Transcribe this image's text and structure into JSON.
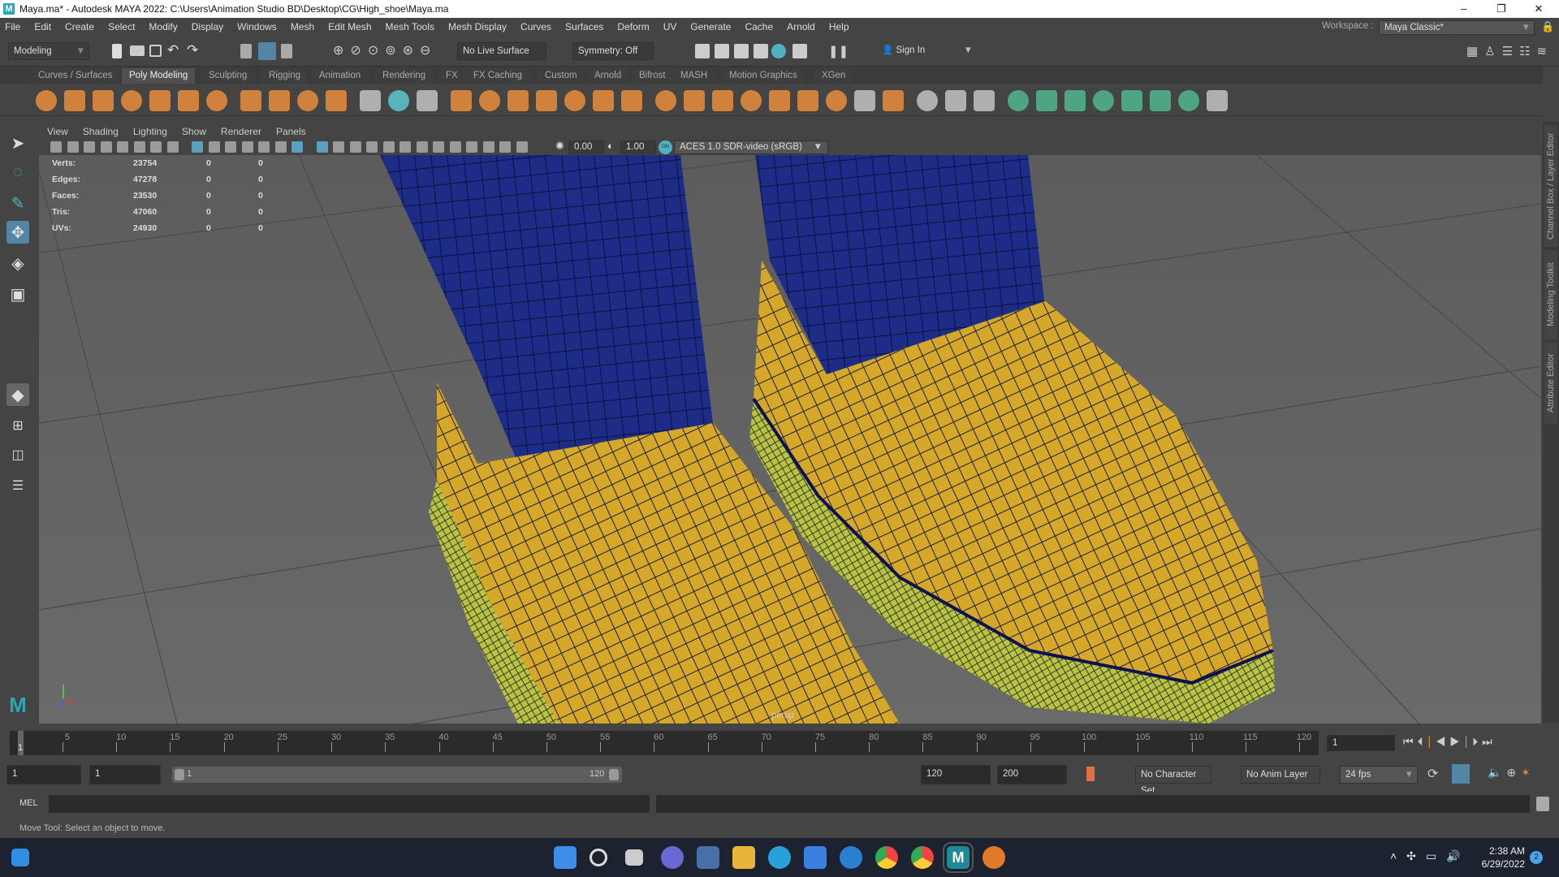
{
  "window": {
    "title": "Maya.ma* - Autodesk MAYA 2022: C:\\Users\\Animation Studio BD\\Desktop\\CG\\High_shoe\\Maya.ma",
    "minimize": "–",
    "maximize": "❐",
    "close": "✕"
  },
  "menubar": [
    "File",
    "Edit",
    "Create",
    "Select",
    "Modify",
    "Display",
    "Windows",
    "Mesh",
    "Edit Mesh",
    "Mesh Tools",
    "Mesh Display",
    "Curves",
    "Surfaces",
    "Deform",
    "UV",
    "Generate",
    "Cache",
    "Arnold",
    "Help"
  ],
  "workspace": {
    "label": "Workspace :",
    "value": "Maya Classic*"
  },
  "statusline": {
    "mode": "Modeling",
    "live_surface": "No Live Surface",
    "symmetry": "Symmetry: Off",
    "sign_in": "Sign In"
  },
  "shelf_tabs": [
    "Curves / Surfaces",
    "Poly Modeling",
    "Sculpting",
    "Rigging",
    "Animation",
    "Rendering",
    "FX",
    "FX Caching",
    "Custom",
    "Arnold",
    "Bifrost",
    "MASH",
    "Motion Graphics",
    "XGen"
  ],
  "active_shelf": "Poly Modeling",
  "shelf_icons": [
    {
      "name": "poly-sphere",
      "color": "#e08a3c"
    },
    {
      "name": "poly-cube",
      "color": "#e08a3c"
    },
    {
      "name": "poly-cylinder",
      "color": "#e08a3c"
    },
    {
      "name": "poly-cone",
      "color": "#e08a3c"
    },
    {
      "name": "poly-torus",
      "color": "#e08a3c"
    },
    {
      "name": "poly-plane",
      "color": "#e08a3c"
    },
    {
      "name": "poly-disc",
      "color": "#e08a3c"
    },
    {
      "name": "platonic-solid",
      "color": "#e08a3c"
    },
    {
      "name": "super-shape",
      "color": "#e08a3c"
    },
    {
      "name": "type",
      "color": "#e08a3c"
    },
    {
      "name": "svg",
      "color": "#e08a3c"
    },
    {
      "name": "combine",
      "color": "#bbbbbb"
    },
    {
      "name": "separate",
      "color": "#5cc0c8"
    },
    {
      "name": "smooth",
      "color": "#bbbbbb"
    },
    {
      "name": "extrude",
      "color": "#e08a3c"
    },
    {
      "name": "bridge",
      "color": "#e08a3c"
    },
    {
      "name": "bevel",
      "color": "#e08a3c"
    },
    {
      "name": "bool",
      "color": "#e08a3c"
    },
    {
      "name": "fill-hole",
      "color": "#e08a3c"
    },
    {
      "name": "mirror",
      "color": "#e08a3c"
    },
    {
      "name": "append",
      "color": "#e08a3c"
    },
    {
      "name": "multi-cut",
      "color": "#e08a3c"
    },
    {
      "name": "target-weld",
      "color": "#e08a3c"
    },
    {
      "name": "connect",
      "color": "#e08a3c"
    },
    {
      "name": "insert-loop",
      "color": "#e08a3c"
    },
    {
      "name": "offset-loop",
      "color": "#e08a3c"
    },
    {
      "name": "merge",
      "color": "#e08a3c"
    },
    {
      "name": "collapse",
      "color": "#e08a3c"
    },
    {
      "name": "quad-draw",
      "color": "#bbbbbb"
    },
    {
      "name": "sculpt",
      "color": "#e08a3c"
    },
    {
      "name": "crease",
      "color": "#bbbbbb"
    },
    {
      "name": "slide-edge",
      "color": "#bbbbbb"
    },
    {
      "name": "knife",
      "color": "#bbbbbb"
    },
    {
      "name": "planar-uv",
      "color": "#4fb08a"
    },
    {
      "name": "cylindrical-uv",
      "color": "#4fb08a"
    },
    {
      "name": "spherical-uv",
      "color": "#4fb08a"
    },
    {
      "name": "auto-uv",
      "color": "#4fb08a"
    },
    {
      "name": "contour-uv",
      "color": "#4fb08a"
    },
    {
      "name": "uv-editor",
      "color": "#4fb08a"
    },
    {
      "name": "uv-toolkit",
      "color": "#4fb08a"
    },
    {
      "name": "uv-unfold",
      "color": "#bbbbbb"
    }
  ],
  "panel_menu": [
    "View",
    "Shading",
    "Lighting",
    "Show",
    "Renderer",
    "Panels"
  ],
  "panel_toolbar": {
    "exposure": "0.00",
    "gamma": "1.00",
    "color_mgmt_toggle": "ON",
    "view_transform": "ACES 1.0 SDR-video (sRGB)"
  },
  "hud": [
    {
      "label": "Verts:",
      "total": "23754",
      "sel": "0",
      "comp": "0"
    },
    {
      "label": "Edges:",
      "total": "47278",
      "sel": "0",
      "comp": "0"
    },
    {
      "label": "Faces:",
      "total": "23530",
      "sel": "0",
      "comp": "0"
    },
    {
      "label": "Tris:",
      "total": "47060",
      "sel": "0",
      "comp": "0"
    },
    {
      "label": "UVs:",
      "total": "24930",
      "sel": "0",
      "comp": "0"
    }
  ],
  "camera_label": "persp",
  "right_tabs": [
    "Channel Box / Layer Editor",
    "Modeling Toolkit",
    "Attribute Editor"
  ],
  "timeslider": {
    "ticks": [
      5,
      10,
      15,
      20,
      25,
      30,
      35,
      40,
      45,
      50,
      55,
      60,
      65,
      70,
      75,
      80,
      85,
      90,
      95,
      100,
      105,
      110,
      115,
      120
    ],
    "current": "1",
    "max": 120,
    "current_frame_field": "1"
  },
  "range": {
    "start": "1",
    "anim_start": "1",
    "range_start": "1",
    "range_end": "120",
    "end": "120",
    "anim_end": "200",
    "character_set": "No Character Set",
    "anim_layer": "No Anim Layer",
    "fps": "24 fps"
  },
  "mel": {
    "label": "MEL"
  },
  "status": "Move Tool: Select an object to move.",
  "taskbar": {
    "time": "2:38 AM",
    "date": "6/29/2022",
    "notifications": "2"
  },
  "colors": {
    "accent": "#5285a6",
    "shoe": "#d6a829",
    "leg": "#1d2c86",
    "sole": "#b9c43a",
    "wire": "#0c1250"
  }
}
